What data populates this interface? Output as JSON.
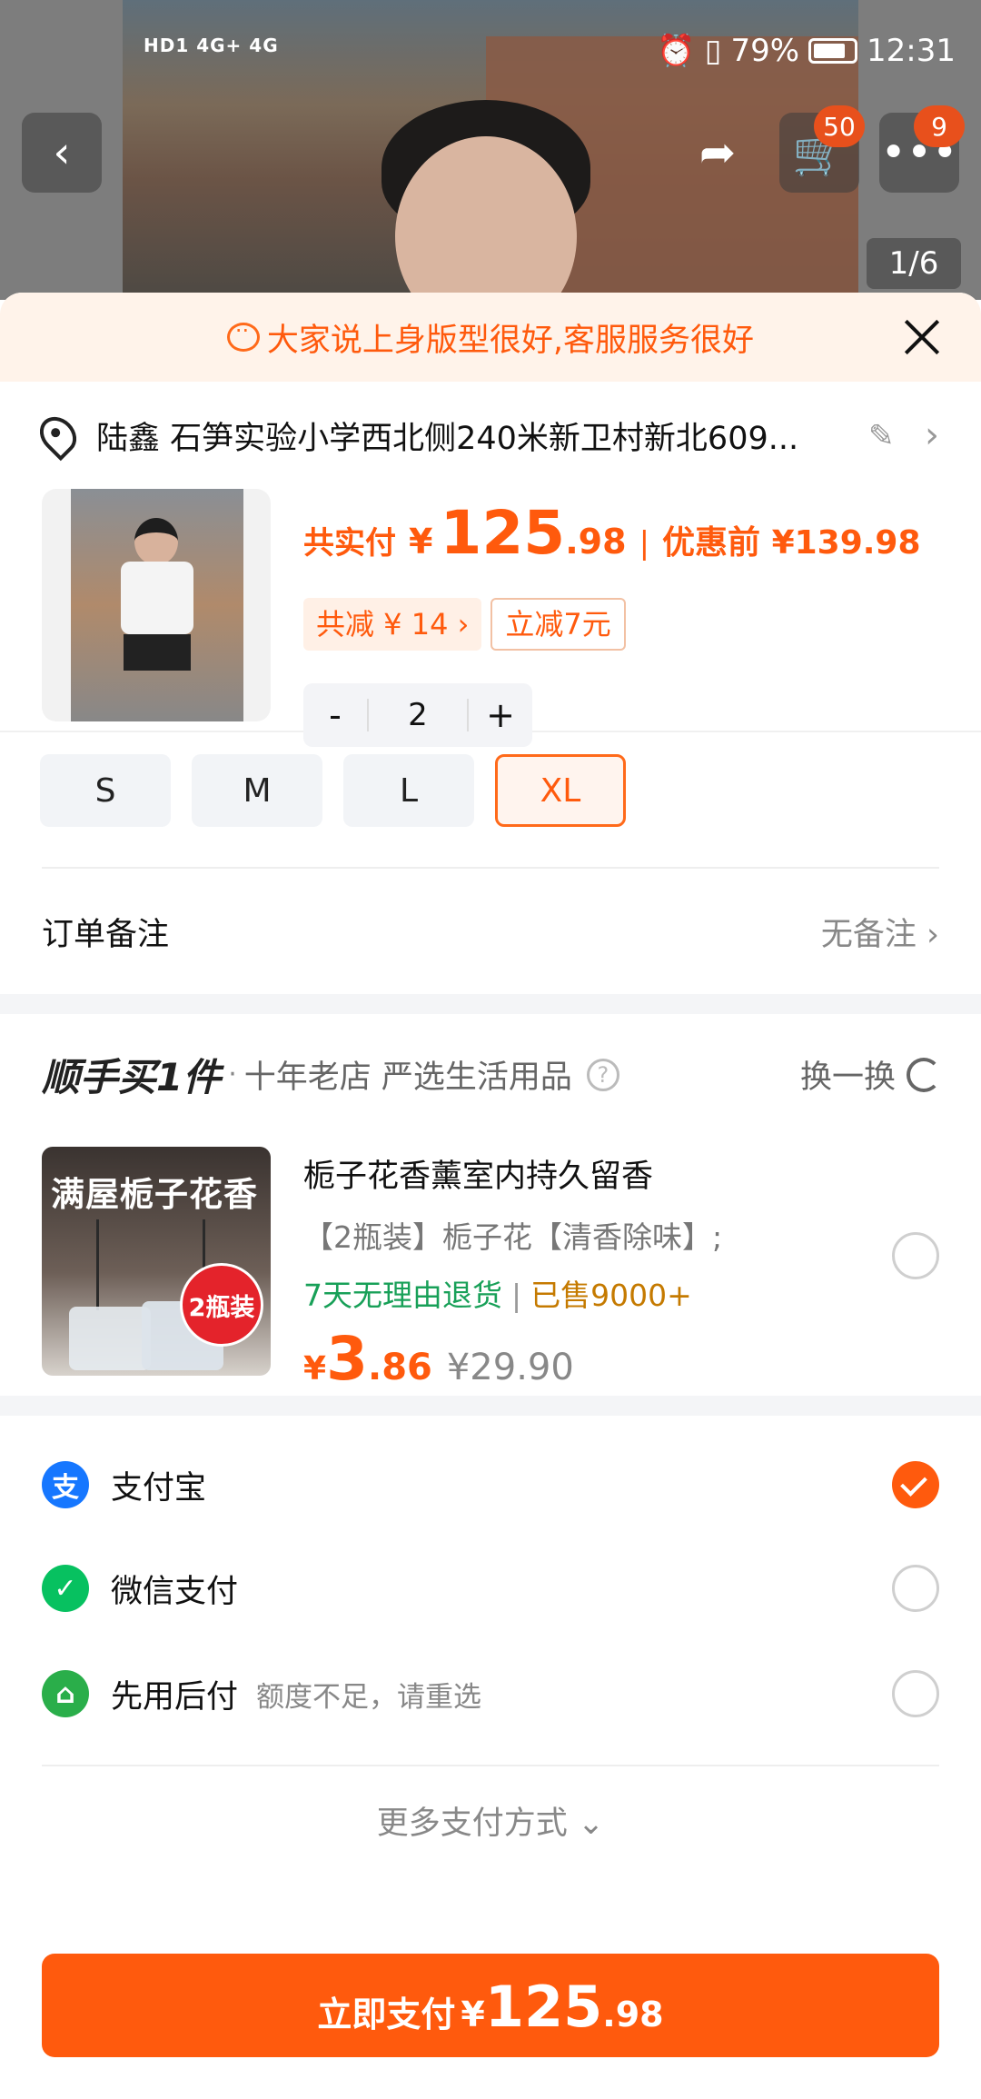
{
  "status_bar": {
    "left_indicators": "HD1 4G+ 4G",
    "battery_percent": "79%",
    "time": "12:31"
  },
  "top_nav": {
    "cart_badge": "50",
    "more_badge": "9",
    "image_pager": "1/6"
  },
  "banner": {
    "text": "大家说上身版型很好,客服服务很好"
  },
  "address": {
    "text": "陆鑫 石笋实验小学西北侧240米新卫村新北609..."
  },
  "product": {
    "price_label": "共实付",
    "currency": "¥",
    "price_integer": "125",
    "price_decimal": ".98",
    "separator": "|",
    "original_price": "优惠前 ¥139.98",
    "coupon_total": "共减 ¥ 14 ›",
    "coupon_instant": "立减7元",
    "quantity": "2",
    "minus": "-",
    "plus": "+"
  },
  "sizes": {
    "options": [
      "S",
      "M",
      "L",
      "XL"
    ],
    "selected": "XL"
  },
  "order_remark": {
    "label": "订单备注",
    "value": "无备注"
  },
  "bundle": {
    "logo": "顺手买1件",
    "dot": "·",
    "subtitle": "十年老店 严选生活用品",
    "help": "?",
    "swap_label": "换一换",
    "thumb_title": "满屋栀子花香",
    "thumb_tag": "2瓶装",
    "title": "栀子花香薰室内持久留香",
    "desc": "【2瓶装】栀子花【清香除味】;",
    "return_policy": "7天无理由退货",
    "sep": "|",
    "sold": "已售9000+",
    "currency": "¥",
    "price_integer": "3",
    "price_decimal": ".86",
    "old_price": "¥29.90"
  },
  "payment": {
    "options": [
      {
        "label": "支付宝",
        "note": "",
        "checked": true,
        "icon": "alipay-icon",
        "color": "#1677ff"
      },
      {
        "label": "微信支付",
        "note": "",
        "checked": false,
        "icon": "wechat-pay-icon",
        "color": "#07c160"
      },
      {
        "label": "先用后付",
        "note": "额度不足，请重选",
        "checked": false,
        "icon": "pay-later-icon",
        "color": "#2aae4a"
      }
    ],
    "more": "更多支付方式 ⌄"
  },
  "pay_button": {
    "label": "立即支付",
    "currency": "¥",
    "integer": "125",
    "decimal": ".98"
  },
  "colors": {
    "accent": "#ff5a0d",
    "banner_bg": "#fff3ea"
  }
}
